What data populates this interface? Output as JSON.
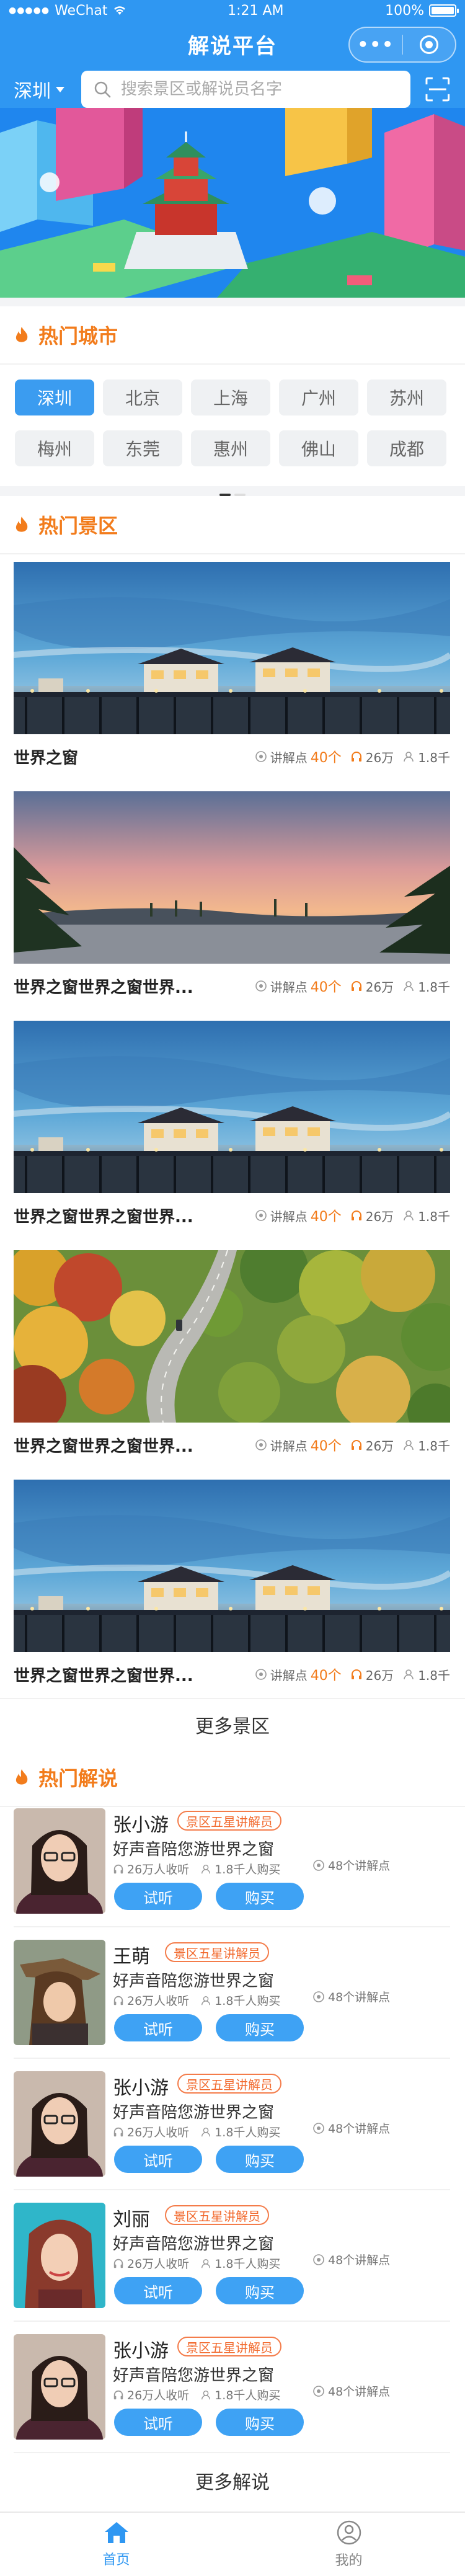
{
  "status": {
    "carrier": "WeChat",
    "time": "1:21 AM",
    "battery": "100%"
  },
  "nav": {
    "title": "解说平台",
    "more": "•••"
  },
  "search": {
    "city": "深圳",
    "placeholder": "搜索景区或解说员名字"
  },
  "hot_cities": {
    "title": "热门城市",
    "items": [
      "深圳",
      "北京",
      "上海",
      "广州",
      "苏州",
      "梅州",
      "东莞",
      "惠州",
      "佛山",
      "成都"
    ],
    "active_index": 0
  },
  "hot_spots": {
    "title": "热门景区",
    "items": [
      {
        "name": "世界之窗",
        "points_label": "讲解点",
        "points": "40个",
        "listens": "26万",
        "buyers": "1.8千"
      },
      {
        "name": "世界之窗世界之窗世界...",
        "points_label": "讲解点",
        "points": "40个",
        "listens": "26万",
        "buyers": "1.8千"
      },
      {
        "name": "世界之窗世界之窗世界...",
        "points_label": "讲解点",
        "points": "40个",
        "listens": "26万",
        "buyers": "1.8千"
      },
      {
        "name": "世界之窗世界之窗世界...",
        "points_label": "讲解点",
        "points": "40个",
        "listens": "26万",
        "buyers": "1.8千"
      },
      {
        "name": "世界之窗世界之窗世界...",
        "points_label": "讲解点",
        "points": "40个",
        "listens": "26万",
        "buyers": "1.8千"
      }
    ],
    "more": "更多景区"
  },
  "hot_guides": {
    "title": "热门解说",
    "items": [
      {
        "name": "张小游",
        "badge": "景区五星讲解员",
        "desc": "好声音陪您游世界之窗",
        "listeners": "26万人收听",
        "buyers": "1.8千人购买",
        "points": "48个讲解点",
        "try": "试听",
        "buy": "购买"
      },
      {
        "name": "王萌",
        "badge": "景区五星讲解员",
        "desc": "好声音陪您游世界之窗",
        "listeners": "26万人收听",
        "buyers": "1.8千人购买",
        "points": "48个讲解点",
        "try": "试听",
        "buy": "购买"
      },
      {
        "name": "张小游",
        "badge": "景区五星讲解员",
        "desc": "好声音陪您游世界之窗",
        "listeners": "26万人收听",
        "buyers": "1.8千人购买",
        "points": "48个讲解点",
        "try": "试听",
        "buy": "购买"
      },
      {
        "name": "刘丽",
        "badge": "景区五星讲解员",
        "desc": "好声音陪您游世界之窗",
        "listeners": "26万人收听",
        "buyers": "1.8千人购买",
        "points": "48个讲解点",
        "try": "试听",
        "buy": "购买"
      },
      {
        "name": "张小游",
        "badge": "景区五星讲解员",
        "desc": "好声音陪您游世界之窗",
        "listeners": "26万人收听",
        "buyers": "1.8千人购买",
        "points": "48个讲解点",
        "try": "试听",
        "buy": "购买"
      }
    ],
    "more": "更多解说"
  },
  "tabbar": {
    "home": "首页",
    "mine": "我的"
  },
  "colors": {
    "primary": "#2f97f2",
    "accent": "#f27c1c"
  }
}
